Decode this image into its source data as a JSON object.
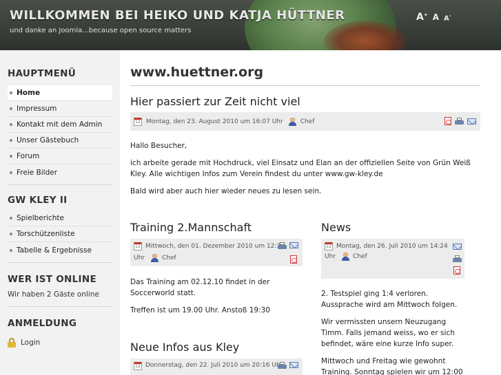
{
  "header": {
    "title": "WILLKOMMEN BEI HEIKO UND KATJA HÜTTNER",
    "slogan": "und danke an Joomla...because open source matters",
    "font_size_controls": {
      "bigger": "A",
      "bigger_sup": "+",
      "reset": "A",
      "smaller": "A",
      "smaller_sup": "-"
    }
  },
  "sidebar": {
    "main_menu": {
      "title": "HAUPTMENÜ",
      "items": [
        {
          "label": "Home",
          "active": true
        },
        {
          "label": "Impressum"
        },
        {
          "label": "Kontakt mit dem Admin"
        },
        {
          "label": "Unser Gästebuch"
        },
        {
          "label": "Forum"
        },
        {
          "label": "Freie Bilder"
        }
      ]
    },
    "gw_kley": {
      "title": "GW KLEY II",
      "items": [
        {
          "label": "Spielberichte"
        },
        {
          "label": "Torschützenliste"
        },
        {
          "label": "Tabelle & Ergebnisse"
        }
      ]
    },
    "who_online": {
      "title": "WER IST ONLINE",
      "text": "Wir haben 2 Gäste online"
    },
    "login": {
      "title": "ANMELDUNG",
      "link": "Login"
    }
  },
  "main": {
    "page_title": "www.huettner.org",
    "lead_article": {
      "title": "Hier passiert zur Zeit nicht viel",
      "date": "Montag, den 23. August 2010 um 16:07 Uhr",
      "author": "Chef",
      "paragraphs": [
        "Hallo Besucher,",
        "ich arbeite gerade mit Hochdruck, viel Einsatz und Elan an der offiziellen Seite von Grün Weiß Kley. Alle wichtigen Infos zum Verein findest du unter www.gw-kley.de",
        "Bald wird aber auch hier wieder neues zu lesen sein."
      ]
    },
    "article_training": {
      "title": "Training 2.Mannschaft",
      "date": "Mittwoch, den 01. Dezember 2010 um 12:35",
      "date_cont": "Uhr",
      "author": "Chef",
      "paragraphs": [
        "Das Training am 02.12.10 findet in der Soccerworld statt.",
        "Treffen ist um 19.00 Uhr. Anstoß 19:30"
      ]
    },
    "article_news": {
      "title": "News",
      "date": "Montag, den 26. Juli 2010 um 14:24",
      "date_cont": "Uhr",
      "author": "Chef",
      "paragraphs": [
        "2. Testspiel ging 1:4 verloren. Aussprache wird am Mittwoch folgen.",
        "Wir vermissten unsern Neuzugang Timm. Falls jemand weiss, wo er sich befindet, wäre eine kurze Info super.",
        "Mittwoch und Freitag wie gewohnt Training. Sonntag spielen wir um 12:00"
      ]
    },
    "article_kley": {
      "title": "Neue Infos aus Kley",
      "date": "Donnerstag, den 22. Juli 2010 um 20:16 Uhr"
    }
  }
}
